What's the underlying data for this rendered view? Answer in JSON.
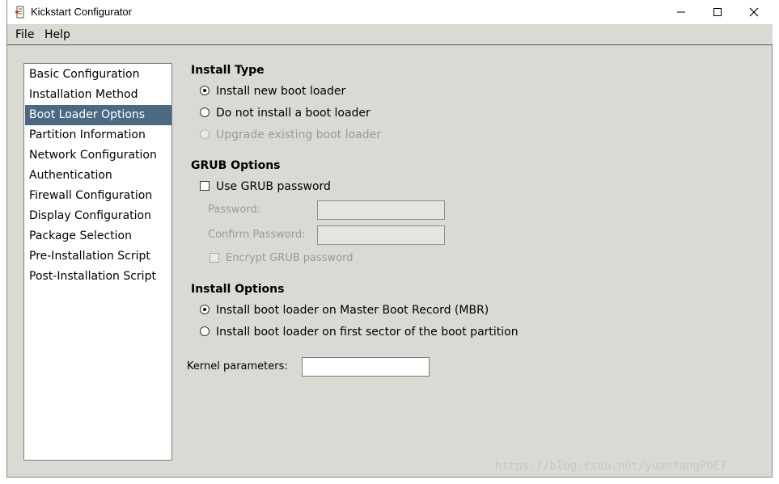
{
  "window": {
    "title": "Kickstart Configurator"
  },
  "menu": [
    {
      "label": "File"
    },
    {
      "label": "Help"
    }
  ],
  "sidebar": {
    "items": [
      {
        "label": "Basic Configuration"
      },
      {
        "label": "Installation Method"
      },
      {
        "label": "Boot Loader Options"
      },
      {
        "label": "Partition Information"
      },
      {
        "label": "Network Configuration"
      },
      {
        "label": "Authentication"
      },
      {
        "label": "Firewall Configuration"
      },
      {
        "label": "Display Configuration"
      },
      {
        "label": "Package Selection"
      },
      {
        "label": "Pre-Installation Script"
      },
      {
        "label": "Post-Installation Script"
      }
    ],
    "selected": "Boot Loader Options"
  },
  "install_type": {
    "title": "Install Type",
    "options": [
      {
        "label": "Install new boot loader",
        "selected": true,
        "enabled": true
      },
      {
        "label": "Do not install a boot loader",
        "selected": false,
        "enabled": true
      },
      {
        "label": "Upgrade existing boot loader",
        "selected": false,
        "enabled": false
      }
    ]
  },
  "grub": {
    "title": "GRUB Options",
    "use_password_label": "Use GRUB password",
    "password_label": "Password:",
    "password_value": "",
    "confirm_label": "Confirm Password:",
    "confirm_value": "",
    "encrypt_label": "Encrypt GRUB password"
  },
  "install_options": {
    "title": "Install Options",
    "options": [
      {
        "label": "Install boot loader on Master Boot Record (MBR)",
        "selected": true
      },
      {
        "label": "Install boot loader on first sector of the boot partition",
        "selected": false
      }
    ]
  },
  "kernel": {
    "label": "Kernel parameters:",
    "value": ""
  },
  "watermark": "https://blog.csdn.net/yuanfangPOET",
  "colors": {
    "selection": "#4b6983",
    "window_bg": "#dbd9d4"
  }
}
